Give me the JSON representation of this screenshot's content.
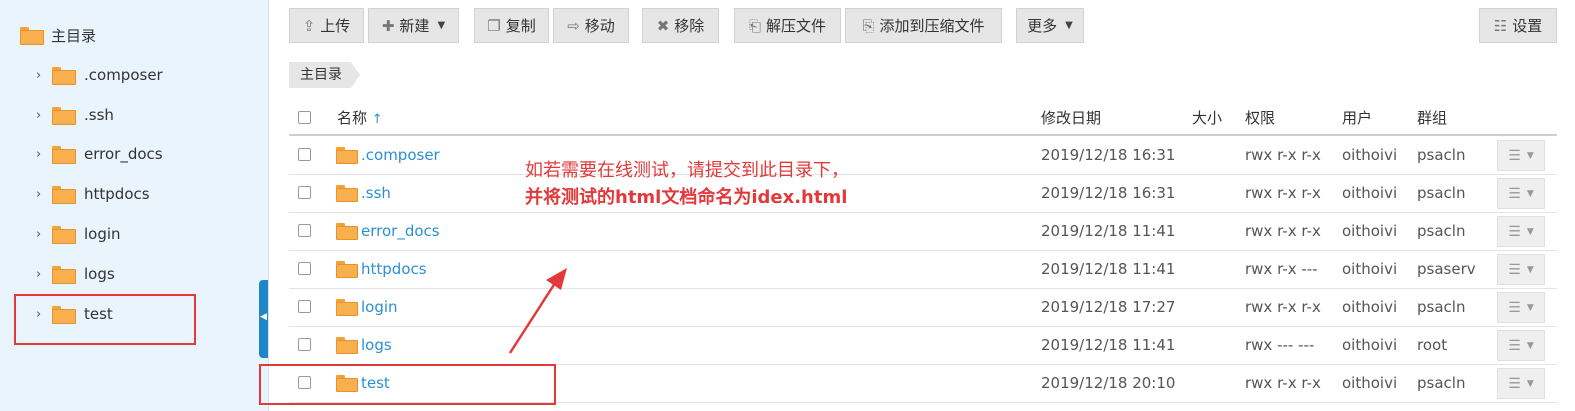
{
  "sidebar": {
    "root_label": "主目录",
    "items": [
      {
        "label": ".composer"
      },
      {
        "label": ".ssh"
      },
      {
        "label": "error_docs"
      },
      {
        "label": "httpdocs"
      },
      {
        "label": "login"
      },
      {
        "label": "logs"
      },
      {
        "label": "test"
      }
    ]
  },
  "toolbar": {
    "upload": "上传",
    "new": "新建",
    "copy": "复制",
    "move": "移动",
    "remove": "移除",
    "extract": "解压文件",
    "compress": "添加到压缩文件",
    "more": "更多",
    "settings": "设置"
  },
  "breadcrumb": "主目录",
  "table": {
    "headers": {
      "name": "名称",
      "sort_arrow": "↑",
      "modified": "修改日期",
      "size": "大小",
      "permissions": "权限",
      "user": "用户",
      "group": "群组"
    },
    "rows": [
      {
        "name": ".composer",
        "modified": "2019/12/18 16:31",
        "size": "",
        "permissions": "rwx r-x r-x",
        "user": "oithoivi",
        "group": "psacln"
      },
      {
        "name": ".ssh",
        "modified": "2019/12/18 16:31",
        "size": "",
        "permissions": "rwx r-x r-x",
        "user": "oithoivi",
        "group": "psacln"
      },
      {
        "name": "error_docs",
        "modified": "2019/12/18 11:41",
        "size": "",
        "permissions": "rwx r-x r-x",
        "user": "oithoivi",
        "group": "psacln"
      },
      {
        "name": "httpdocs",
        "modified": "2019/12/18 11:41",
        "size": "",
        "permissions": "rwx r-x ---",
        "user": "oithoivi",
        "group": "psaserv"
      },
      {
        "name": "login",
        "modified": "2019/12/18 17:27",
        "size": "",
        "permissions": "rwx r-x r-x",
        "user": "oithoivi",
        "group": "psacln"
      },
      {
        "name": "logs",
        "modified": "2019/12/18 11:41",
        "size": "",
        "permissions": "rwx --- ---",
        "user": "oithoivi",
        "group": "root"
      },
      {
        "name": "test",
        "modified": "2019/12/18 20:10",
        "size": "",
        "permissions": "rwx r-x r-x",
        "user": "oithoivi",
        "group": "psacln"
      }
    ]
  },
  "annotation": {
    "line1": "如若需要在线测试，请提交到此目录下，",
    "line2": "并将测试的html文档命名为idex.html",
    "color": "#e3393a"
  },
  "colors": {
    "sidebar_bg": "#e9f4fc",
    "link": "#2b8fd6",
    "folder": "#f7b04d",
    "collapse_tab": "#1f86c8"
  }
}
